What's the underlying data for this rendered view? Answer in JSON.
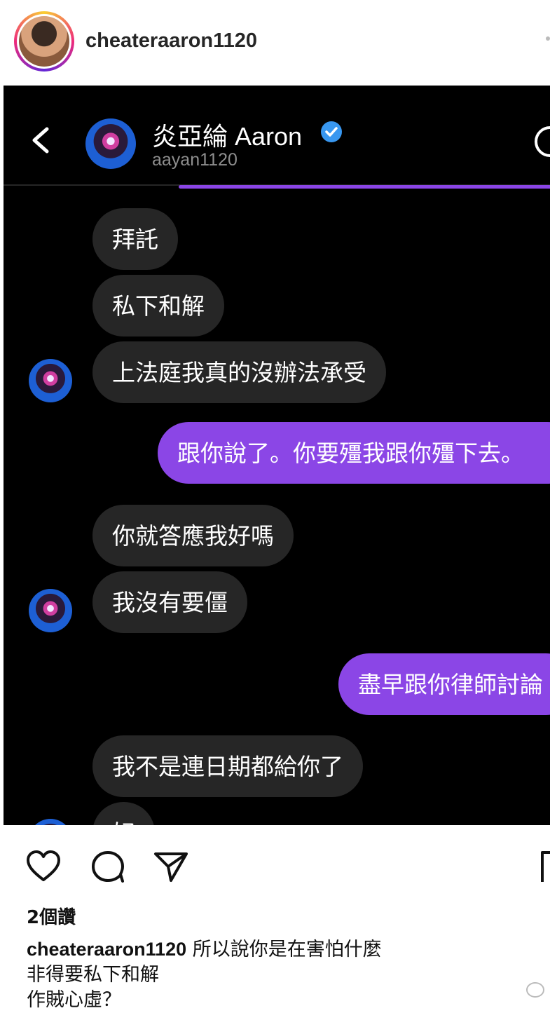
{
  "post": {
    "username": "cheateraaron1120",
    "likes": "2個讚",
    "caption_user": "cheateraaron1120",
    "caption_lines": [
      "所以說你是在害怕什麼",
      "非得要私下和解",
      "作賊心虛？"
    ]
  },
  "dm": {
    "contact_name": "炎亞綸 Aaron",
    "contact_handle": "aayan1120",
    "messages": [
      {
        "from": "them",
        "text": "拜託"
      },
      {
        "from": "them",
        "text": "私下和解"
      },
      {
        "from": "them",
        "text": "上法庭我真的沒辦法承受"
      },
      {
        "from": "me",
        "text": "跟你說了。你要殭我跟你殭下去。"
      },
      {
        "from": "them",
        "text": "你就答應我好嗎"
      },
      {
        "from": "them",
        "text": "我沒有要僵"
      },
      {
        "from": "me",
        "text": "盡早跟你律師討論"
      },
      {
        "from": "them",
        "text": "我不是連日期都給你了"
      },
      {
        "from": "them",
        "text": "好"
      }
    ]
  },
  "colors": {
    "dm_background": "#000000",
    "incoming_bubble": "#262626",
    "outgoing_bubble": "#8b46e6",
    "verified": "#3897f0"
  },
  "icons": [
    "back-icon",
    "verified-icon",
    "info-icon",
    "heart-icon",
    "comment-icon",
    "share-icon",
    "bookmark-icon"
  ]
}
